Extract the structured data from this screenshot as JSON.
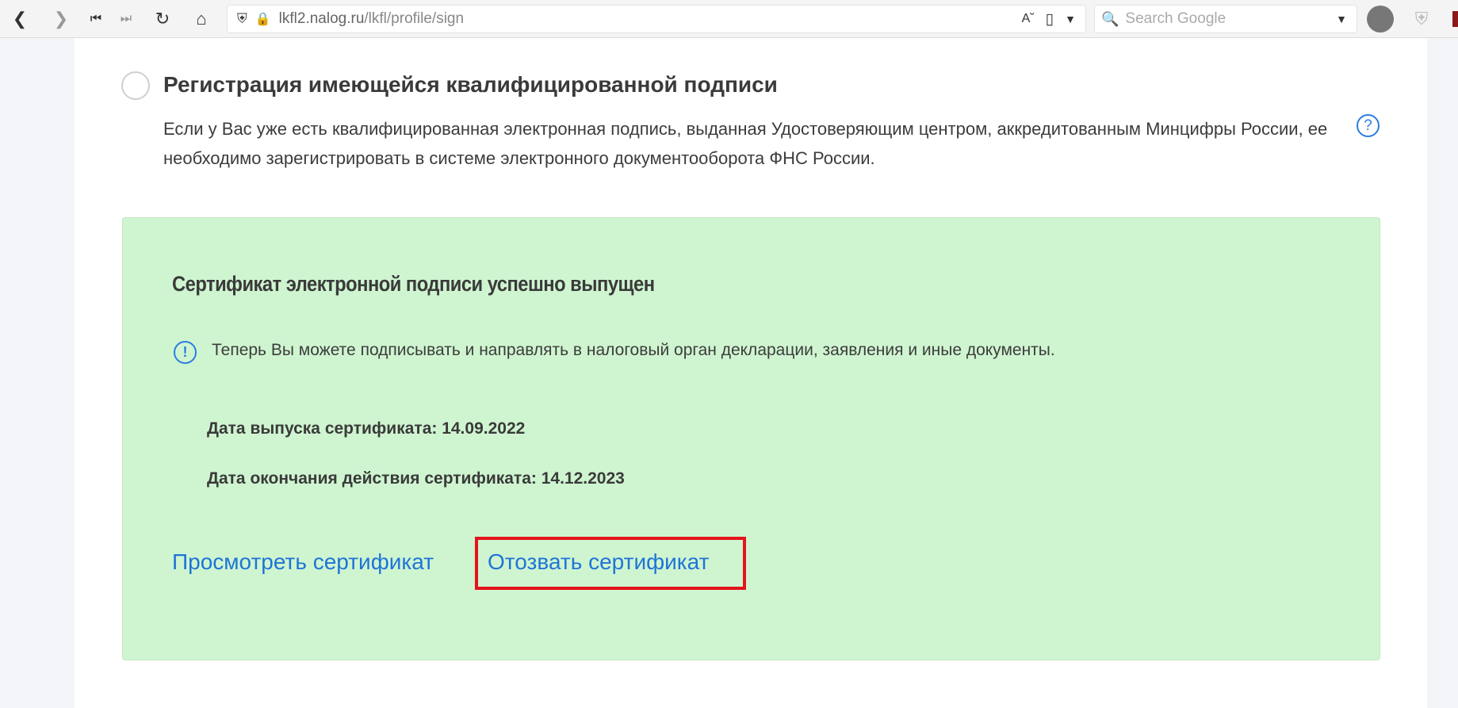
{
  "browser": {
    "url_host": "lkfl2.nalog.ru",
    "url_path": "/lkfl/profile/sign",
    "search_placeholder": "Search Google"
  },
  "section": {
    "title": "Регистрация имеющейся квалифицированной подписи",
    "description": "Если у Вас уже есть квалифицированная электронная подпись, выданная Удостоверяющим центром, аккредитованным Минцифры России, ее необходимо зарегистрировать в системе электронного документооборота ФНС России.",
    "help": "?"
  },
  "certificate": {
    "title": "Сертификат электронной подписи успешно выпущен",
    "info_icon": "!",
    "info": "Теперь Вы можете подписывать и направлять в налоговый орган декларации, заявления и иные документы.",
    "issue_date": "Дата выпуска сертификата: 14.09.2022",
    "expiry_date": "Дата окончания действия сертификата: 14.12.2023",
    "view_link": "Просмотреть сертификат",
    "revoke_link": "Отозвать сертификат"
  },
  "colors": {
    "success_bg": "#cff5d0",
    "link": "#1f74d8",
    "highlight": "#e3141c"
  }
}
